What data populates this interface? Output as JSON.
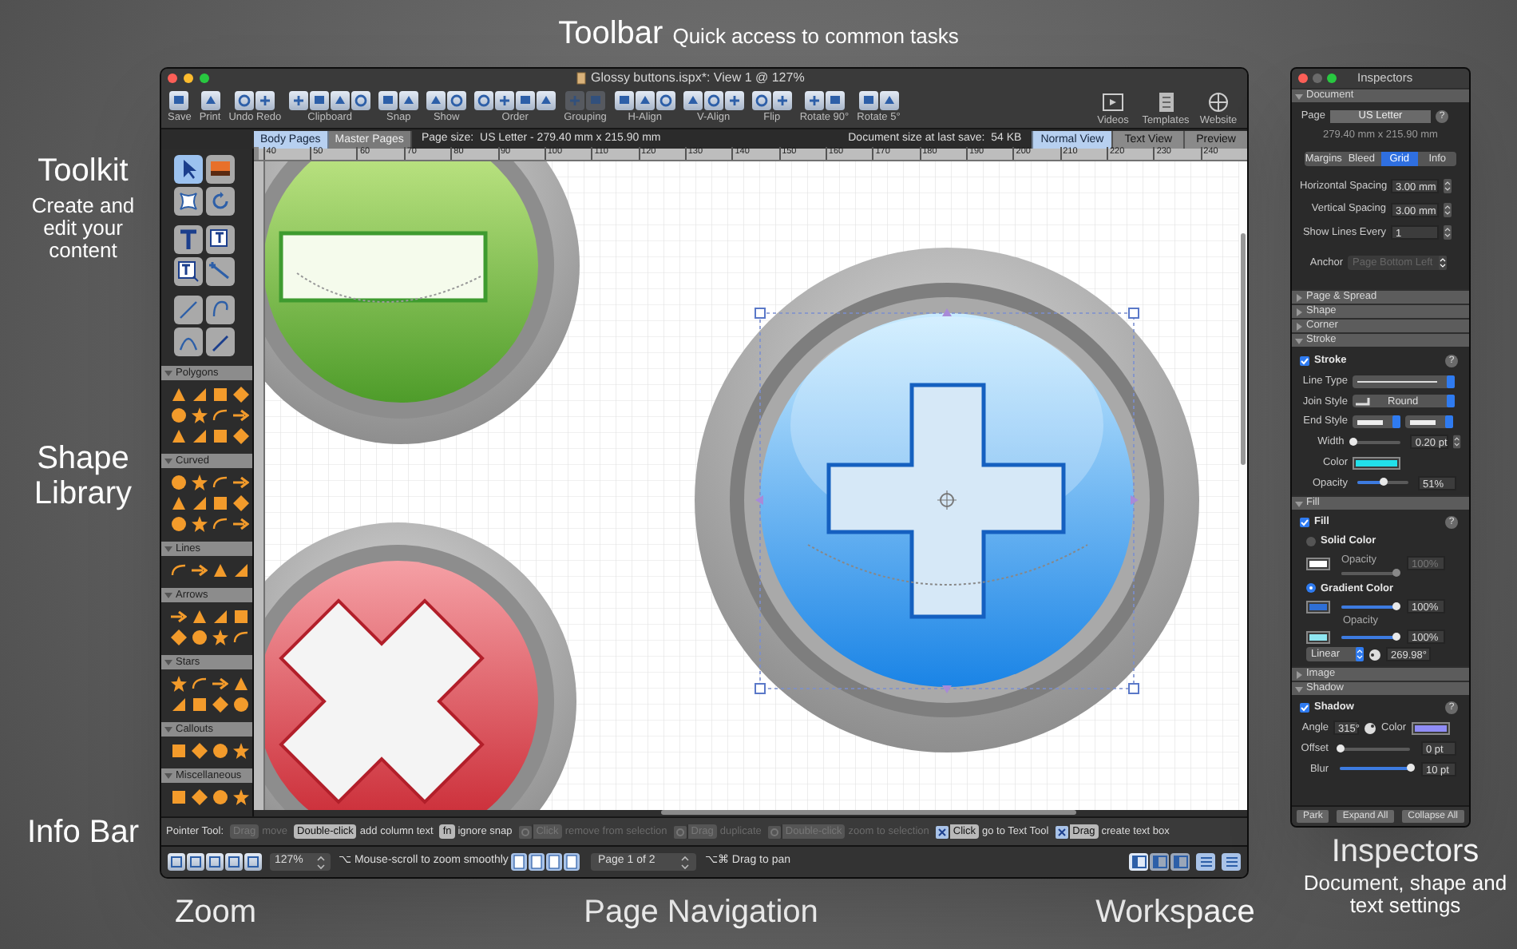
{
  "callouts": [
    {
      "title": "Toolbar",
      "subtitle": "Quick access to common tasks"
    },
    {
      "title": "Toolkit",
      "subtitle": "Create and edit your content"
    },
    {
      "title": "Shape Library"
    },
    {
      "title": "Info Bar"
    },
    {
      "title": "Zoom"
    },
    {
      "title": "Page Navigation"
    },
    {
      "title": "Workspace"
    },
    {
      "title": "Inspectors",
      "subtitle": "Document, shape and text settings"
    }
  ],
  "window": {
    "title": "Glossy buttons.ispx*: View 1 @ 127%"
  },
  "toolbar": {
    "groups": [
      {
        "label": "Save",
        "disabled": false
      },
      {
        "label": "Print",
        "disabled": false
      },
      {
        "label": "Undo Redo",
        "disabled": false
      },
      {
        "label": "Clipboard",
        "disabled": false
      },
      {
        "label": "Snap",
        "disabled": false
      },
      {
        "label": "Show",
        "disabled": false
      },
      {
        "label": "Order",
        "disabled": false
      },
      {
        "label": "Grouping",
        "disabled": true
      },
      {
        "label": "H-Align",
        "disabled": false
      },
      {
        "label": "V-Align",
        "disabled": false
      },
      {
        "label": "Flip",
        "disabled": false
      },
      {
        "label": "Rotate 90°",
        "disabled": false
      },
      {
        "label": "Rotate 5°",
        "disabled": false
      }
    ],
    "links": [
      {
        "label": "Videos"
      },
      {
        "label": "Templates"
      },
      {
        "label": "Website"
      }
    ]
  },
  "page_tabs": [
    {
      "label": "Body Pages",
      "selected": true
    },
    {
      "label": "Master Pages",
      "selected": false
    }
  ],
  "page_size": "Page size:  US Letter - 279.40 mm x 215.90 mm",
  "document_size": "Document size at last save:  54 KB",
  "view_tabs": [
    {
      "label": "Normal View",
      "selected": true
    },
    {
      "label": "Text View",
      "selected": false
    },
    {
      "label": "Preview",
      "selected": false
    }
  ],
  "ruler": [
    "40",
    "50",
    "60",
    "70",
    "80",
    "90",
    "100",
    "110",
    "120",
    "130",
    "140",
    "150",
    "160",
    "170",
    "180",
    "190",
    "200",
    "210",
    "220",
    "230",
    "240"
  ],
  "tools": [
    {
      "selected": true
    },
    {
      "selected": false
    },
    {
      "selected": false
    },
    {
      "selected": false
    },
    {
      "selected": false
    },
    {
      "selected": false
    },
    {
      "selected": false
    },
    {
      "selected": false
    },
    {
      "selected": false
    },
    {
      "selected": false
    },
    {
      "selected": false
    },
    {
      "selected": false
    }
  ],
  "shape_library": [
    {
      "label": "Polygons",
      "expanded": true
    },
    {
      "label": "Curved",
      "expanded": true
    },
    {
      "label": "Lines",
      "expanded": true
    },
    {
      "label": "Arrows",
      "expanded": true
    },
    {
      "label": "Stars",
      "expanded": true
    },
    {
      "label": "Callouts",
      "expanded": true
    },
    {
      "label": "Miscellaneous",
      "expanded": true
    }
  ],
  "info_bar": {
    "label": "Pointer Tool:",
    "hints": [
      {
        "key": "Drag",
        "text": "move",
        "enabled": false,
        "modifier": false
      },
      {
        "key": "Double-click",
        "text": "add column text",
        "enabled": true,
        "modifier": false
      },
      {
        "key": "fn",
        "text": "ignore snap",
        "enabled": true,
        "modifier": false
      },
      {
        "key": "Click",
        "text": "remove from selection",
        "enabled": false,
        "modifier": true
      },
      {
        "key": "Drag",
        "text": "duplicate",
        "enabled": false,
        "modifier": true
      },
      {
        "key": "Double-click",
        "text": "zoom to selection",
        "enabled": false,
        "modifier": true
      },
      {
        "key": "Click",
        "text": "go to Text Tool",
        "enabled": true,
        "modifier": true
      },
      {
        "key": "Drag",
        "text": "create text box",
        "enabled": true,
        "modifier": true
      }
    ]
  },
  "status_bar": {
    "zoom": "127%",
    "zoom_hint": "⌥ Mouse-scroll to zoom smoothly",
    "page": "Page 1 of 2",
    "pan_hint": "⌥⌘ Drag to pan",
    "workspace": [
      {
        "selected": true
      },
      {
        "selected": false
      },
      {
        "selected": false
      }
    ]
  },
  "inspectors": {
    "title": "Inspectors",
    "document": {
      "header": "Document",
      "expanded": true,
      "help": "?",
      "page_label": "Page",
      "page_value": "US Letter",
      "page_size": "279.40 mm x 215.90 mm",
      "tabs": [
        {
          "label": "Margins",
          "selected": false
        },
        {
          "label": "Bleed",
          "selected": false
        },
        {
          "label": "Grid",
          "selected": true
        },
        {
          "label": "Info",
          "selected": false
        }
      ],
      "fields": [
        {
          "label": "Horizontal Spacing",
          "value": "3.00 mm"
        },
        {
          "label": "Vertical Spacing",
          "value": "3.00 mm"
        },
        {
          "label": "Show Lines Every",
          "value": "1"
        }
      ],
      "anchor": {
        "label": "Anchor",
        "value": "Page Bottom Left",
        "disabled": true
      }
    },
    "collapsed": [
      {
        "header": "Page & Spread",
        "expanded": false
      },
      {
        "header": "Shape",
        "expanded": false
      },
      {
        "header": "Corner",
        "expanded": false
      }
    ],
    "stroke": {
      "header": "Stroke",
      "expanded": true,
      "help": "?",
      "label": "Stroke",
      "checked": true,
      "line_type_label": "Line Type",
      "join_label": "Join Style",
      "join_value": "Round",
      "end_label": "End Style",
      "width": {
        "label": "Width",
        "level": 0,
        "reading": "0.20 pt"
      },
      "color_label": "Color",
      "color": "#22e0ea",
      "opacity": {
        "label": "Opacity",
        "level": 0.5,
        "reading": "51%"
      }
    },
    "fill": {
      "header": "Fill",
      "expanded": true,
      "help": "?",
      "label": "Fill",
      "checked": true,
      "solid": {
        "label": "Solid Color",
        "selected": false,
        "color": "#ffffff",
        "opacity_label": "Opacity",
        "level": 1,
        "reading": "100%",
        "disabled": true
      },
      "gradient": {
        "label": "Gradient Color",
        "selected": true,
        "opacity_label": "Opacity",
        "stops": [
          {
            "color": "#2f6fd6",
            "level": 1,
            "reading": "100%"
          },
          {
            "color": "#8fe6f2",
            "level": 1,
            "reading": "100%"
          }
        ],
        "type": "Linear",
        "angle": "269.98°"
      }
    },
    "image": {
      "header": "Image",
      "expanded": false
    },
    "shadow": {
      "header": "Shadow",
      "expanded": true,
      "help": "?",
      "label": "Shadow",
      "checked": true,
      "angle_label": "Angle",
      "angle": "315°",
      "color_label": "Color",
      "color": "#8f8cf5",
      "offset": {
        "label": "Offset",
        "level": 0,
        "reading": "0 pt"
      },
      "blur": {
        "label": "Blur",
        "level": 1,
        "reading": "10 pt"
      }
    },
    "buttons": [
      "Park",
      "Expand All",
      "Collapse All"
    ]
  }
}
